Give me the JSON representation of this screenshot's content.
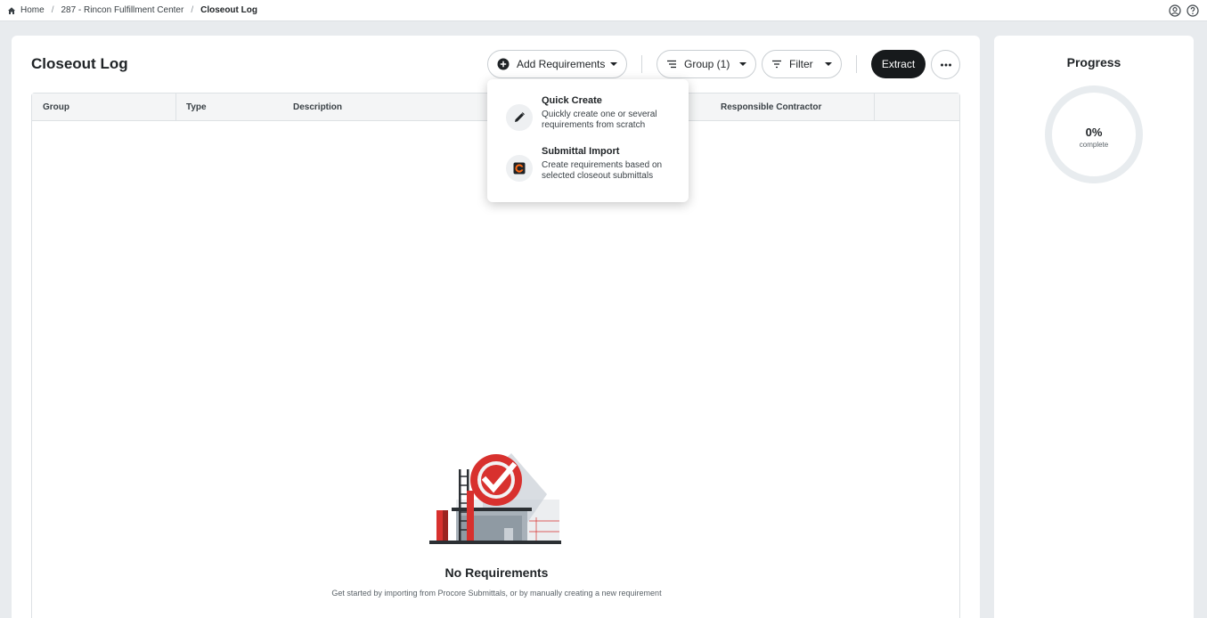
{
  "breadcrumb": {
    "home": "Home",
    "project": "287 - Rincon Fulfillment Center",
    "current": "Closeout Log",
    "separator": "/"
  },
  "page": {
    "title": "Closeout Log"
  },
  "toolbar": {
    "add_requirements": "Add Requirements",
    "group": "Group (1)",
    "filter": "Filter",
    "extract": "Extract"
  },
  "table": {
    "columns": [
      "Group",
      "Type",
      "Description",
      "Responsible Contractor"
    ]
  },
  "menu": {
    "items": [
      {
        "title": "Quick Create",
        "description": "Quickly create one or several requirements from scratch",
        "icon": "pencil-icon"
      },
      {
        "title": "Submittal Import",
        "description": "Create requirements based on selected closeout submittals",
        "icon": "procore-logo-icon"
      }
    ]
  },
  "empty_state": {
    "title": "No Requirements",
    "subtitle": "Get started by importing from Procore Submittals, or by manually creating a new requirement"
  },
  "progress": {
    "title": "Progress",
    "percent_label": "0%",
    "percent_value": 0,
    "caption": "complete"
  },
  "colors": {
    "accent_dark": "#171a1c",
    "brand_red": "#d8312e",
    "ring_track": "#e8ecef"
  }
}
